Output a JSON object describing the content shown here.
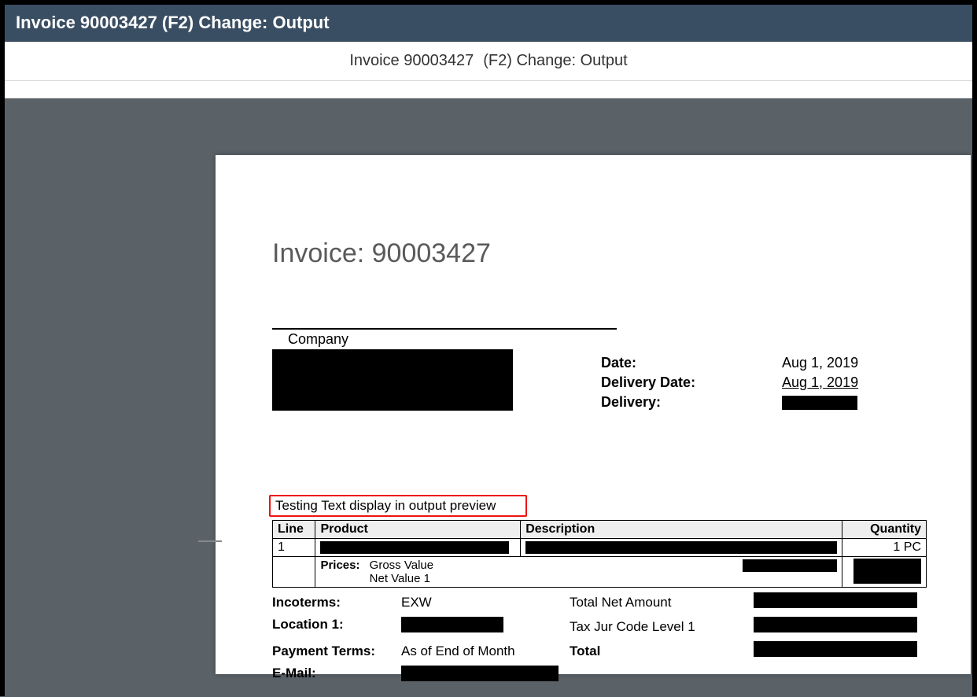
{
  "window": {
    "title": "Invoice 90003427 (F2) Change: Output"
  },
  "subheader": {
    "left": "Invoice 90003427",
    "right": "(F2) Change: Output"
  },
  "invoice": {
    "heading": "Invoice: 90003427",
    "company_label": "Company",
    "meta": {
      "date_label": "Date:",
      "date_value": "Aug 1, 2019",
      "delivery_date_label": "Delivery Date:",
      "delivery_date_value": "Aug 1, 2019",
      "delivery_label": "Delivery:"
    },
    "highlight_text": "Testing Text display in output preview",
    "table": {
      "headers": {
        "line": "Line",
        "product": "Product",
        "description": "Description",
        "quantity": "Quantity"
      },
      "rows": [
        {
          "line": "1",
          "quantity": "1 PC"
        }
      ],
      "prices_label": "Prices:",
      "price_lines": [
        "Gross Value",
        "Net Value 1"
      ]
    },
    "footer": {
      "incoterms_label": "Incoterms:",
      "incoterms_value": "EXW",
      "location1_label": "Location 1:",
      "payment_terms_label": "Payment Terms:",
      "payment_terms_value": "As of End of Month",
      "email_label": "E-Mail:",
      "total_net_label": "Total Net Amount",
      "tax_label": "Tax Jur Code Level 1",
      "total_label": "Total"
    }
  }
}
